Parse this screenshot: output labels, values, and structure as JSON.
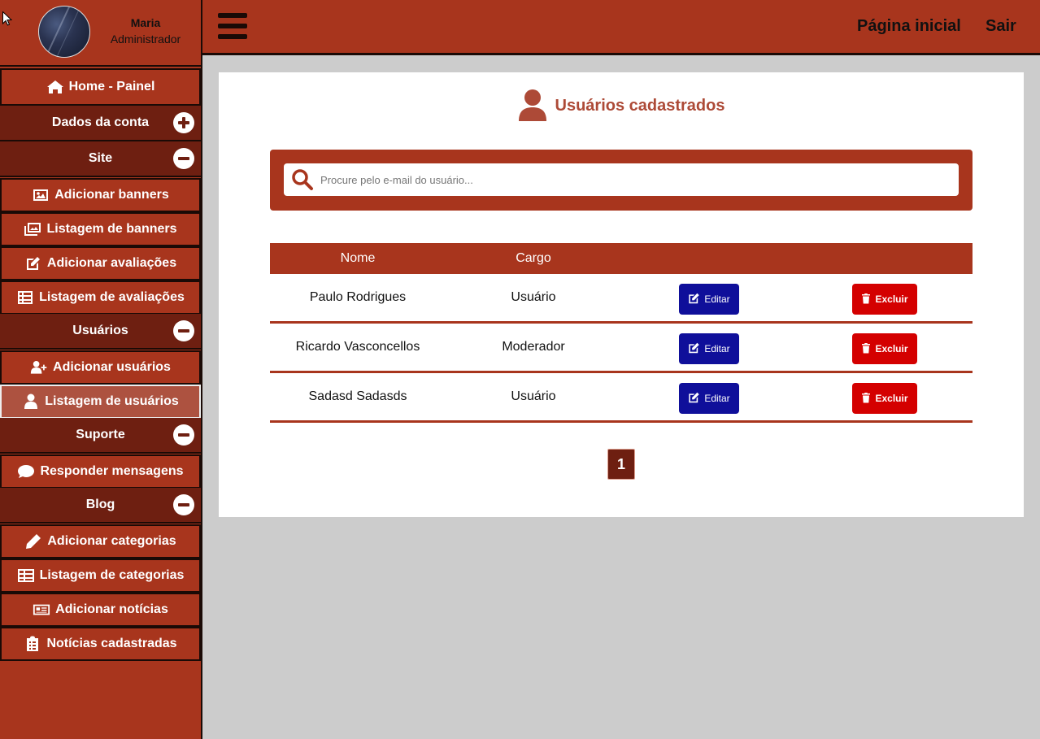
{
  "profile": {
    "name": "Maria",
    "role": "Administrador"
  },
  "sidebar": {
    "items": [
      {
        "type": "link",
        "label": "Home - Painel",
        "icon": "home-icon"
      },
      {
        "type": "section",
        "label": "Dados da conta",
        "toggle": "plus"
      },
      {
        "type": "section",
        "label": "Site",
        "toggle": "minus"
      },
      {
        "type": "link",
        "label": "Adicionar banners",
        "icon": "image-icon"
      },
      {
        "type": "link",
        "label": "Listagem de banners",
        "icon": "images-icon"
      },
      {
        "type": "link",
        "label": "Adicionar avaliações",
        "icon": "edit-icon"
      },
      {
        "type": "link",
        "label": "Listagem de avaliações",
        "icon": "list-icon"
      },
      {
        "type": "section",
        "label": "Usuários",
        "toggle": "minus"
      },
      {
        "type": "link",
        "label": "Adicionar usuários",
        "icon": "user-plus-icon"
      },
      {
        "type": "link",
        "label": "Listagem de usuários",
        "icon": "user-icon",
        "active": true
      },
      {
        "type": "section",
        "label": "Suporte",
        "toggle": "minus"
      },
      {
        "type": "link",
        "label": "Responder mensagens",
        "icon": "comment-icon"
      },
      {
        "type": "section",
        "label": "Blog",
        "toggle": "minus"
      },
      {
        "type": "link",
        "label": "Adicionar categorias",
        "icon": "pencil-icon"
      },
      {
        "type": "link",
        "label": "Listagem de categorias",
        "icon": "table-icon"
      },
      {
        "type": "link",
        "label": "Adicionar notícias",
        "icon": "newspaper-icon"
      },
      {
        "type": "link",
        "label": "Notícias cadastradas",
        "icon": "clipboard-list-icon"
      }
    ]
  },
  "topbar": {
    "home_label": "Página inicial",
    "logout_label": "Sair"
  },
  "main": {
    "title": "Usuários cadastrados",
    "search": {
      "placeholder": "Procure pelo e-mail do usuário..."
    },
    "table": {
      "headers": [
        "Nome",
        "Cargo"
      ],
      "rows": [
        {
          "name": "Paulo Rodrigues",
          "role": "Usuário"
        },
        {
          "name": "Ricardo Vasconcellos",
          "role": "Moderador"
        },
        {
          "name": "Sadasd Sadasds",
          "role": "Usuário"
        }
      ],
      "edit_label": "Editar",
      "delete_label": "Excluir"
    },
    "pagination": {
      "current": "1"
    }
  },
  "colors": {
    "primary": "#a8351d",
    "dark": "#6e1f11",
    "edit": "#0f0f9a",
    "delete": "#d40000"
  }
}
